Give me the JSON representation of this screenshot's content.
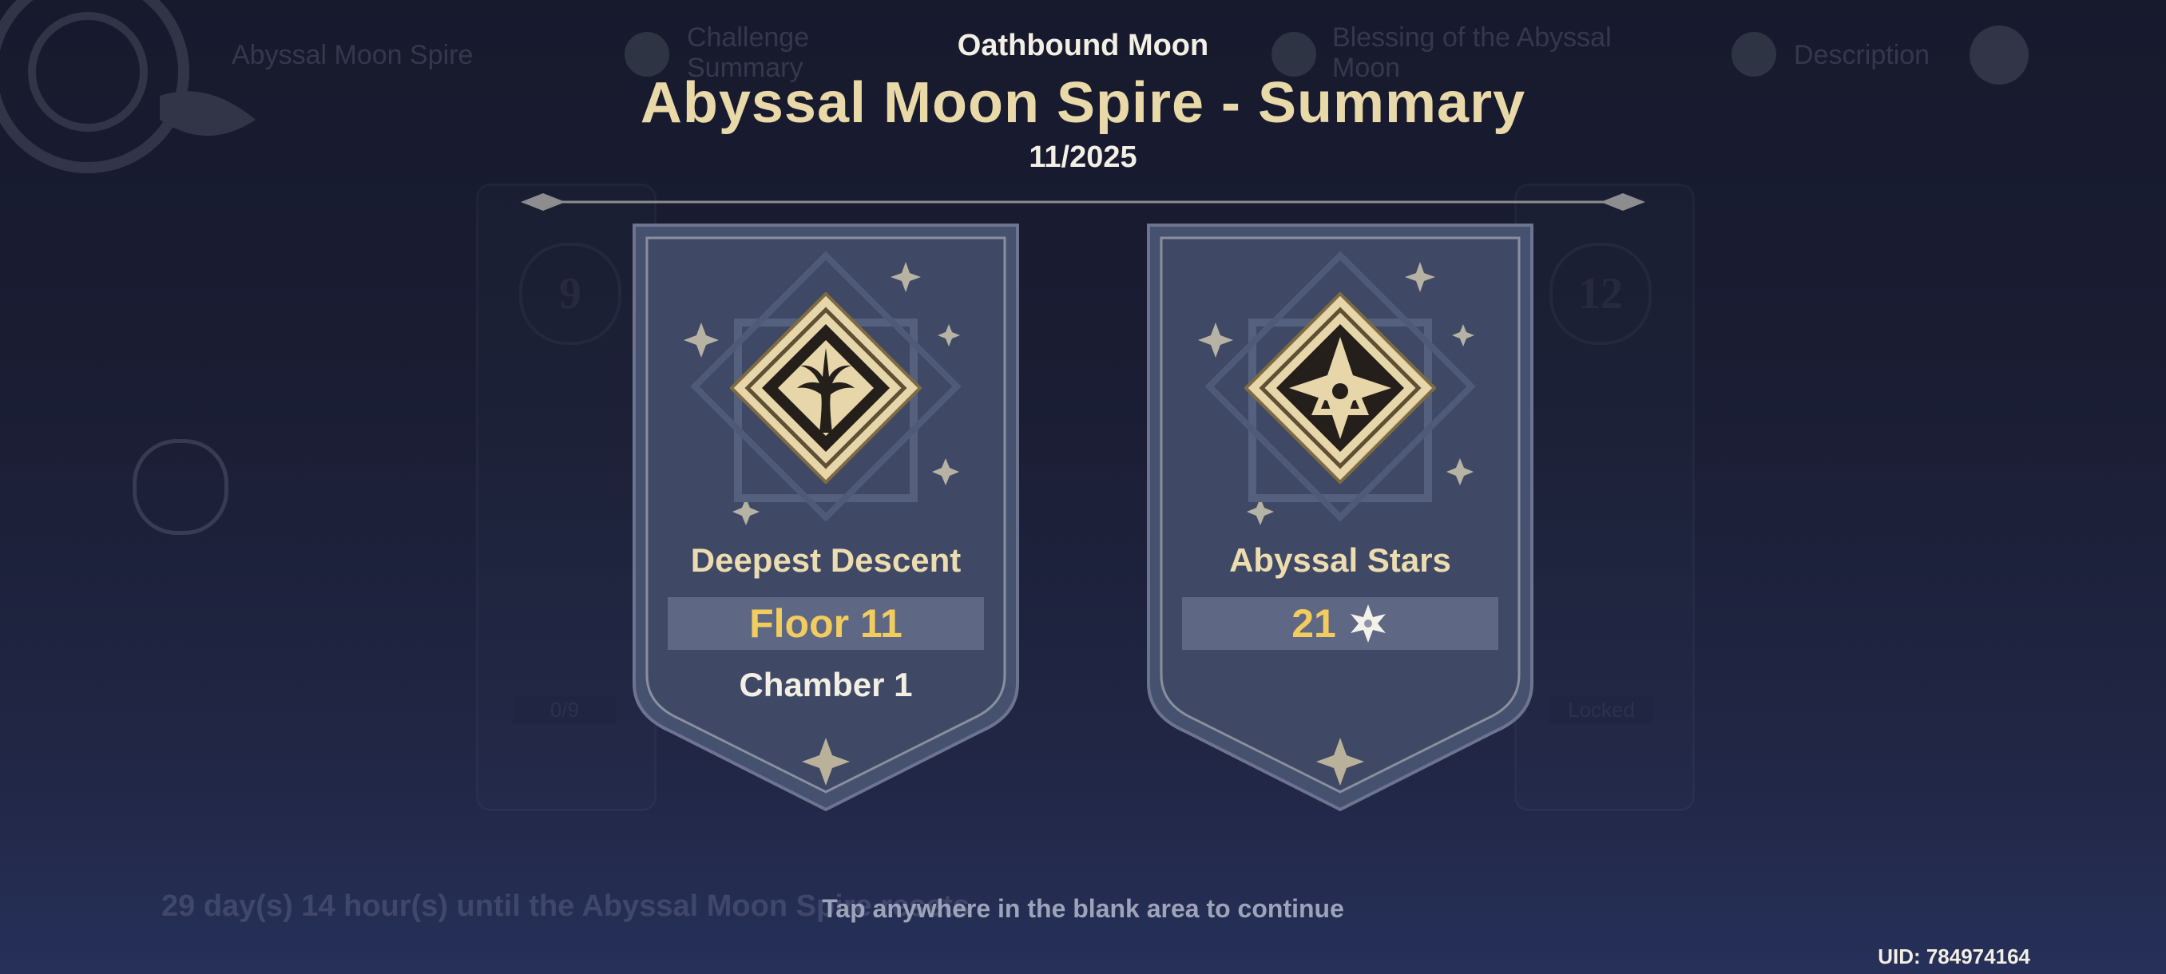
{
  "background_menu": {
    "tabs": [
      {
        "label": "Abyssal Moon Spire",
        "icon": "moon-icon"
      },
      {
        "label": "Challenge Summary",
        "icon": "summary-icon"
      },
      {
        "label": "Blessing of the Abyssal Moon",
        "icon": "blessing-icon"
      },
      {
        "label": "Description",
        "icon": "question-icon"
      }
    ],
    "close_icon": "close-icon",
    "left_floor": "9",
    "right_floor": "12",
    "left_progress": "0/9",
    "right_status": "Locked",
    "countdown": "29 day(s) 14 hour(s) until the Abyssal Moon Spire resets"
  },
  "header": {
    "subtitle": "Oathbound Moon",
    "title": "Abyssal Moon Spire - Summary",
    "date": "11/2025"
  },
  "cards": {
    "descent": {
      "icon": "tree-emblem-icon",
      "label": "Deepest Descent",
      "value": "Floor 11",
      "extra": "Chamber 1"
    },
    "stars": {
      "icon": "star-emblem-icon",
      "label": "Abyssal Stars",
      "value": "21",
      "value_icon": "abyssal-star-icon"
    }
  },
  "footer": {
    "tip": "Tap anywhere in the blank area to continue",
    "uid": "UID: 784974164"
  },
  "colors": {
    "gold": "#ead9a8",
    "value_yellow": "#f2cc5e",
    "card_fill": "#3f4966",
    "background": "#1a1d33"
  }
}
